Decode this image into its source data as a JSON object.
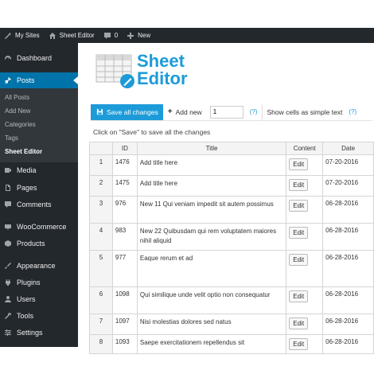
{
  "adminbar": {
    "my_sites": "My Sites",
    "site_name": "Sheet Editor",
    "comments_count": "0",
    "new_label": "New"
  },
  "sidebar": {
    "items": [
      {
        "label": "Dashboard",
        "icon": "dashboard-icon"
      },
      {
        "label": "Posts",
        "icon": "pin-icon"
      },
      {
        "label": "Media",
        "icon": "media-icon"
      },
      {
        "label": "Pages",
        "icon": "pages-icon"
      },
      {
        "label": "Comments",
        "icon": "comments-icon"
      },
      {
        "label": "WooCommerce",
        "icon": "woocommerce-icon"
      },
      {
        "label": "Products",
        "icon": "products-icon"
      },
      {
        "label": "Appearance",
        "icon": "brush-icon"
      },
      {
        "label": "Plugins",
        "icon": "plugin-icon"
      },
      {
        "label": "Users",
        "icon": "user-icon"
      },
      {
        "label": "Tools",
        "icon": "wrench-icon"
      },
      {
        "label": "Settings",
        "icon": "settings-icon"
      }
    ],
    "submenu": [
      "All Posts",
      "Add New",
      "Categories",
      "Tags",
      "Sheet Editor"
    ]
  },
  "logo": {
    "line1": "Sheet",
    "line2": "Editor"
  },
  "toolbar": {
    "save_label": "Save all changes",
    "add_new_label": "Add new",
    "add_new_value": "1",
    "help_label": "(?)",
    "simple_text_label": "Show cells as simple text",
    "help2_label": "(?)"
  },
  "hint": "Click on \"Save\" to save all the changes",
  "table": {
    "columns": [
      "",
      "ID",
      "Title",
      "Content",
      "Date"
    ],
    "edit_label": "Edit",
    "rows": [
      {
        "num": "1",
        "id": "1476",
        "title": "Add title here",
        "date": "07-20-2016"
      },
      {
        "num": "2",
        "id": "1475",
        "title": "Add title here",
        "date": "07-20-2016"
      },
      {
        "num": "3",
        "id": "976",
        "title": "New 11 Qui veniam impedit sit autem possimus",
        "date": "06-28-2016"
      },
      {
        "num": "4",
        "id": "983",
        "title": "New 22 Quibusdam qui rem voluptatem maiores nihil aliquid",
        "date": "06-28-2016"
      },
      {
        "num": "5",
        "id": "977",
        "title": "Eaque rerum et ad",
        "date": "06-28-2016"
      },
      {
        "num": "6",
        "id": "1098",
        "title": "Qui similique unde velit optio non consequatur",
        "date": "06-28-2016"
      },
      {
        "num": "7",
        "id": "1097",
        "title": "Nisi molestias dolores sed natus",
        "date": "06-28-2016"
      },
      {
        "num": "8",
        "id": "1093",
        "title": "Saepe exercitationem repellendus sit",
        "date": "06-28-2016"
      }
    ]
  },
  "colors": {
    "accent": "#1d9bd9",
    "admin_dark": "#23282d",
    "active_blue": "#0073aa"
  }
}
